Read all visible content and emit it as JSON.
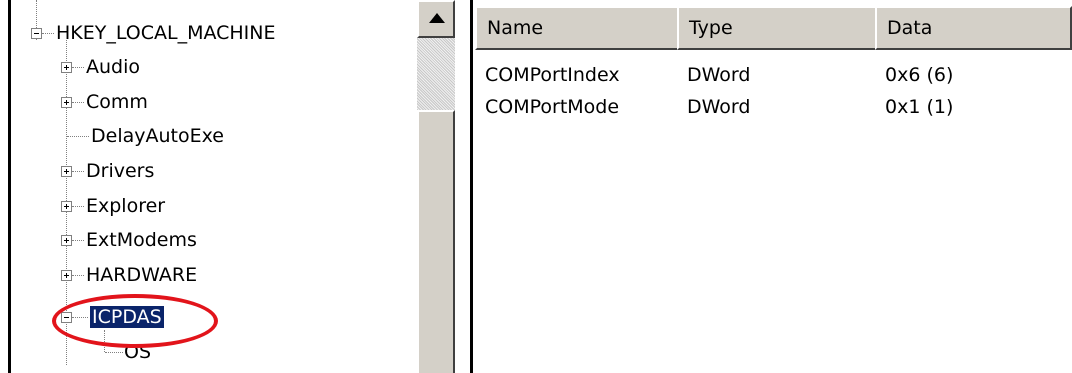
{
  "tree": {
    "root": {
      "label": "HKEY_LOCAL_MACHINE",
      "expander": "−"
    },
    "items": [
      {
        "label": "Audio",
        "expander": "+"
      },
      {
        "label": "Comm",
        "expander": "+"
      },
      {
        "label": "DelayAutoExe",
        "expander": ""
      },
      {
        "label": "Drivers",
        "expander": "+"
      },
      {
        "label": "Explorer",
        "expander": "+"
      },
      {
        "label": "ExtModems",
        "expander": "+"
      },
      {
        "label": "HARDWARE",
        "expander": "+"
      },
      {
        "label": "ICPDAS",
        "expander": "−",
        "selected": true
      },
      {
        "label": "OS",
        "expander": ""
      }
    ]
  },
  "list": {
    "columns": [
      "Name",
      "Type",
      "Data"
    ],
    "rows": [
      {
        "name": "COMPortIndex",
        "type": "DWord",
        "data": "0x6 (6)"
      },
      {
        "name": "COMPortMode",
        "type": "DWord",
        "data": "0x1 (1)"
      }
    ]
  },
  "colors": {
    "selection": "#0a246a",
    "highlight_ellipse": "#e2141b",
    "chrome": "#d4d0c8"
  },
  "icons": {
    "scroll_up": "arrow-up-icon",
    "collapse": "minus-box-icon",
    "expand": "plus-box-icon"
  }
}
